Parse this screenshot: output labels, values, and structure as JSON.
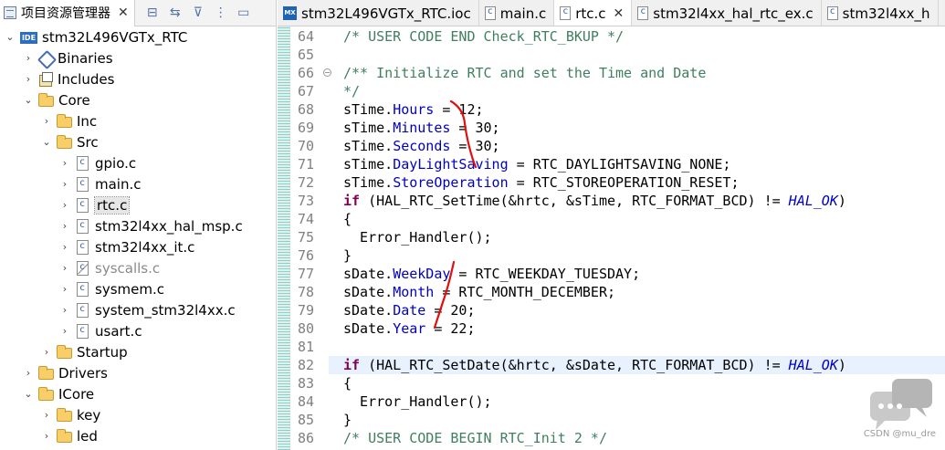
{
  "explorer": {
    "tab_label": "项目资源管理器",
    "close_glyph": "✕",
    "tools": [
      {
        "icon": "collapse-all-icon",
        "glyph": "⊟"
      },
      {
        "icon": "link-with-editor-icon",
        "glyph": "⇆"
      },
      {
        "icon": "filter-icon",
        "glyph": "⊽"
      },
      {
        "icon": "view-menu-icon",
        "glyph": "⋮"
      },
      {
        "icon": "minimize-icon",
        "glyph": "▭"
      }
    ],
    "tree": [
      {
        "label": "stm32L496VGTx_RTC",
        "depth": 0,
        "chevron": "⌄",
        "icon": "ide"
      },
      {
        "label": "Binaries",
        "depth": 1,
        "chevron": "›",
        "icon": "binaries"
      },
      {
        "label": "Includes",
        "depth": 1,
        "chevron": "›",
        "icon": "includes"
      },
      {
        "label": "Core",
        "depth": 1,
        "chevron": "⌄",
        "icon": "folder"
      },
      {
        "label": "Inc",
        "depth": 2,
        "chevron": "›",
        "icon": "folder"
      },
      {
        "label": "Src",
        "depth": 2,
        "chevron": "⌄",
        "icon": "folder"
      },
      {
        "label": "gpio.c",
        "depth": 3,
        "chevron": "›",
        "icon": "cfile"
      },
      {
        "label": "main.c",
        "depth": 3,
        "chevron": "›",
        "icon": "cfile"
      },
      {
        "label": "rtc.c",
        "depth": 3,
        "chevron": "›",
        "icon": "cfile",
        "selected": true
      },
      {
        "label": "stm32l4xx_hal_msp.c",
        "depth": 3,
        "chevron": "›",
        "icon": "cfile"
      },
      {
        "label": "stm32l4xx_it.c",
        "depth": 3,
        "chevron": "›",
        "icon": "cfile"
      },
      {
        "label": "syscalls.c",
        "depth": 3,
        "chevron": "›",
        "icon": "cfile",
        "muted": true
      },
      {
        "label": "sysmem.c",
        "depth": 3,
        "chevron": "›",
        "icon": "cfile"
      },
      {
        "label": "system_stm32l4xx.c",
        "depth": 3,
        "chevron": "›",
        "icon": "cfile"
      },
      {
        "label": "usart.c",
        "depth": 3,
        "chevron": "›",
        "icon": "cfile"
      },
      {
        "label": "Startup",
        "depth": 2,
        "chevron": "›",
        "icon": "folder"
      },
      {
        "label": "Drivers",
        "depth": 1,
        "chevron": "›",
        "icon": "folder"
      },
      {
        "label": "ICore",
        "depth": 1,
        "chevron": "⌄",
        "icon": "folder"
      },
      {
        "label": "key",
        "depth": 2,
        "chevron": "›",
        "icon": "folder"
      },
      {
        "label": "led",
        "depth": 2,
        "chevron": "›",
        "icon": "folder"
      }
    ]
  },
  "editor": {
    "tabs": [
      {
        "label": "stm32L496VGTx_RTC.ioc",
        "icon": "mx",
        "active": false,
        "closable": false
      },
      {
        "label": "main.c",
        "icon": "cfile",
        "active": false,
        "closable": false
      },
      {
        "label": "rtc.c",
        "icon": "cfile",
        "active": true,
        "closable": true
      },
      {
        "label": "stm32l4xx_hal_rtc_ex.c",
        "icon": "cfile",
        "active": false,
        "closable": false
      },
      {
        "label": "stm32l4xx_h",
        "icon": "cfile",
        "active": false,
        "closable": false
      }
    ],
    "close_glyph": "✕",
    "fold_glyph": "⊖",
    "current_line": 82,
    "lines": [
      {
        "no": "64",
        "tokens": [
          [
            "cm",
            "/* USER CODE END Check_RTC_BKUP */"
          ]
        ]
      },
      {
        "no": "65",
        "tokens": []
      },
      {
        "no": "66",
        "fold": true,
        "tokens": [
          [
            "cm",
            "/** Initialize RTC and set the Time and Date"
          ]
        ]
      },
      {
        "no": "67",
        "tokens": [
          [
            "cm",
            "*/"
          ]
        ]
      },
      {
        "no": "68",
        "tokens": [
          [
            "id",
            "sTime."
          ],
          [
            "fd",
            "Hours"
          ],
          [
            "id",
            " = 12;"
          ]
        ]
      },
      {
        "no": "69",
        "tokens": [
          [
            "id",
            "sTime."
          ],
          [
            "fd",
            "Minutes"
          ],
          [
            "id",
            " = 30;"
          ]
        ]
      },
      {
        "no": "70",
        "tokens": [
          [
            "id",
            "sTime."
          ],
          [
            "fd",
            "Seconds"
          ],
          [
            "id",
            " = 30;"
          ]
        ]
      },
      {
        "no": "71",
        "tokens": [
          [
            "id",
            "sTime."
          ],
          [
            "fd",
            "DayLightSaving"
          ],
          [
            "id",
            " = RTC_DAYLIGHTSAVING_NONE;"
          ]
        ]
      },
      {
        "no": "72",
        "tokens": [
          [
            "id",
            "sTime."
          ],
          [
            "fd",
            "StoreOperation"
          ],
          [
            "id",
            " = RTC_STOREOPERATION_RESET;"
          ]
        ]
      },
      {
        "no": "73",
        "tokens": [
          [
            "kw",
            "if"
          ],
          [
            "id",
            " (HAL_RTC_SetTime(&hrtc, &sTime, RTC_FORMAT_BCD) != "
          ],
          [
            "it",
            "HAL_OK"
          ],
          [
            "id",
            ")"
          ]
        ]
      },
      {
        "no": "74",
        "tokens": [
          [
            "id",
            "{"
          ]
        ]
      },
      {
        "no": "75",
        "tokens": [
          [
            "id",
            "  Error_Handler();"
          ]
        ]
      },
      {
        "no": "76",
        "tokens": [
          [
            "id",
            "}"
          ]
        ]
      },
      {
        "no": "77",
        "tokens": [
          [
            "id",
            "sDate."
          ],
          [
            "fd",
            "WeekDay"
          ],
          [
            "id",
            " = RTC_WEEKDAY_TUESDAY;"
          ]
        ]
      },
      {
        "no": "78",
        "tokens": [
          [
            "id",
            "sDate."
          ],
          [
            "fd",
            "Month"
          ],
          [
            "id",
            " = RTC_MONTH_DECEMBER;"
          ]
        ]
      },
      {
        "no": "79",
        "tokens": [
          [
            "id",
            "sDate."
          ],
          [
            "fd",
            "Date"
          ],
          [
            "id",
            " = 20;"
          ]
        ]
      },
      {
        "no": "80",
        "tokens": [
          [
            "id",
            "sDate."
          ],
          [
            "fd",
            "Year"
          ],
          [
            "id",
            " = 22;"
          ]
        ]
      },
      {
        "no": "81",
        "tokens": []
      },
      {
        "no": "82",
        "tokens": [
          [
            "kw",
            "if"
          ],
          [
            "id",
            " (HAL_RTC_SetDate(&hrtc, &sDate, RTC_FORMAT_BCD) != "
          ],
          [
            "it",
            "HAL_OK"
          ],
          [
            "id",
            ")"
          ]
        ]
      },
      {
        "no": "83",
        "tokens": [
          [
            "id",
            "{"
          ]
        ]
      },
      {
        "no": "84",
        "tokens": [
          [
            "id",
            "  Error_Handler();"
          ]
        ]
      },
      {
        "no": "85",
        "tokens": [
          [
            "id",
            "}"
          ]
        ]
      },
      {
        "no": "86",
        "tokens": [
          [
            "cm",
            "/* USER CODE BEGIN RTC_Init 2 */"
          ]
        ]
      }
    ]
  },
  "colors": {
    "comment": "#3f7f5f",
    "keyword": "#7f0055",
    "field": "#0000c0",
    "annotation_stroke": "#e01010",
    "current_line": "#e8f2fe"
  },
  "watermark": {
    "icon": "chat-bubbles-icon",
    "text": "CSDN @mu_dre"
  }
}
